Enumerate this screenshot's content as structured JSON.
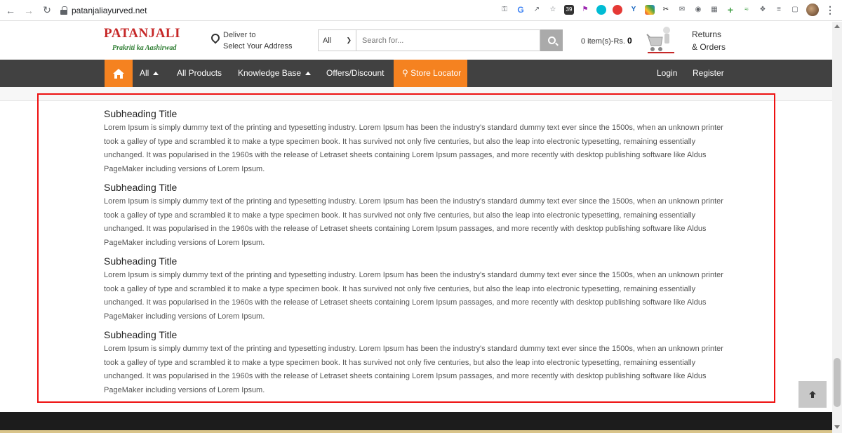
{
  "browser": {
    "url": "patanjaliayurved.net",
    "calendar_badge": "39"
  },
  "header": {
    "logo_name": "PATANJALI",
    "logo_tagline": "Prakriti ka Aashirwad",
    "deliver_line1": "Deliver to",
    "deliver_line2": "Select Your Address",
    "search_category": "All",
    "search_placeholder": "Search for...",
    "cart_label": "0 item(s)-Rs.",
    "cart_amount": "0",
    "returns_line1": "Returns",
    "returns_line2": "& Orders"
  },
  "nav": {
    "all": "All",
    "all_products": "All Products",
    "knowledge_base": "Knowledge Base",
    "offers": "Offers/Discount",
    "store_locator": "Store Locator",
    "login": "Login",
    "register": "Register"
  },
  "content": {
    "sections": [
      {
        "title": "Subheading Title",
        "text": "Lorem Ipsum is simply dummy text of the printing and typesetting industry. Lorem Ipsum has been the industry's standard dummy text ever since the 1500s, when an unknown printer took a galley of type and scrambled it to make a type specimen book. It has survived not only five centuries, but also the leap into electronic typesetting, remaining essentially unchanged. It was popularised in the 1960s with the release of Letraset sheets containing Lorem Ipsum passages, and more recently with desktop publishing software like Aldus PageMaker including versions of Lorem Ipsum."
      },
      {
        "title": "Subheading Title",
        "text": "Lorem Ipsum is simply dummy text of the printing and typesetting industry. Lorem Ipsum has been the industry's standard dummy text ever since the 1500s, when an unknown printer took a galley of type and scrambled it to make a type specimen book. It has survived not only five centuries, but also the leap into electronic typesetting, remaining essentially unchanged. It was popularised in the 1960s with the release of Letraset sheets containing Lorem Ipsum passages, and more recently with desktop publishing software like Aldus PageMaker including versions of Lorem Ipsum."
      },
      {
        "title": "Subheading Title",
        "text": "Lorem Ipsum is simply dummy text of the printing and typesetting industry. Lorem Ipsum has been the industry's standard dummy text ever since the 1500s, when an unknown printer took a galley of type and scrambled it to make a type specimen book. It has survived not only five centuries, but also the leap into electronic typesetting, remaining essentially unchanged. It was popularised in the 1960s with the release of Letraset sheets containing Lorem Ipsum passages, and more recently with desktop publishing software like Aldus PageMaker including versions of Lorem Ipsum."
      },
      {
        "title": "Subheading Title",
        "text": "Lorem Ipsum is simply dummy text of the printing and typesetting industry. Lorem Ipsum has been the industry's standard dummy text ever since the 1500s, when an unknown printer took a galley of type and scrambled it to make a type specimen book. It has survived not only five centuries, but also the leap into electronic typesetting, remaining essentially unchanged. It was popularised in the 1960s with the release of Letraset sheets containing Lorem Ipsum passages, and more recently with desktop publishing software like Aldus PageMaker including versions of Lorem Ipsum."
      }
    ]
  },
  "colors": {
    "brand_orange": "#f58220",
    "nav_dark": "#414141",
    "logo_red": "#c62828",
    "logo_green": "#2e7d32",
    "highlight_red": "#ee1111"
  }
}
